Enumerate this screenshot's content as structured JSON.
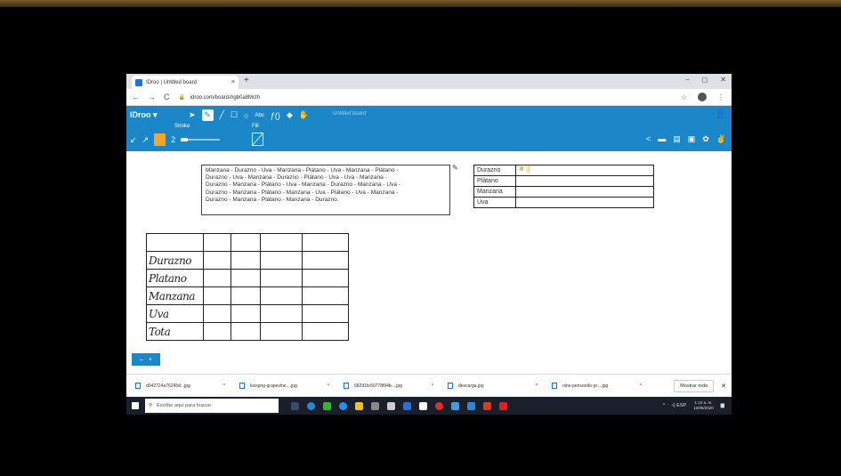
{
  "browser": {
    "tab_title": "IDroo | Untitled board",
    "tab_close": "×",
    "new_tab": "+",
    "win_min": "–",
    "win_max": "◻",
    "win_close": "✕",
    "nav_back": "←",
    "nav_forward": "→",
    "nav_reload": "C",
    "url": "idroo.com/board-hgb0a8Mcth",
    "star": "☆",
    "menu": "⋮"
  },
  "toolbar": {
    "logo": "IDroo ▾",
    "select_icon": "➤",
    "pencil_icon": "✎",
    "line_icon": "╱",
    "rect_icon": "☐",
    "ellipse_icon": "○",
    "text_icon": "Abc",
    "formula_icon": "ƒ()",
    "eraser_icon": "◆",
    "hand_icon": "✋",
    "board_title": "Untitled board",
    "stroke_label": "Stroke",
    "fill_label": "Fill",
    "stroke_width": "2",
    "undo_icon": "↙",
    "redo_icon": "↗",
    "share_icon": "<",
    "chat_icon": "▬",
    "doc_icon": "▤",
    "image_icon": "▣",
    "settings_icon": "✿",
    "hand2_icon": "✌",
    "user_icon": "👤",
    "stroke_color": "#f5a623",
    "accent": "#1b87c9"
  },
  "canvas": {
    "text_lines": [
      "Manzana - Durazno - Uva - Manzana - Plátano - Uva - Manzana - Plátano -",
      "Durazno - Uva - Manzana - Durazno - Plátano - Uva - Uva - Manzana -",
      "Durazno - Manzana - Plátano - Uva - Manzana - Durazno - Manzana - Uva -",
      "Durazno - Manzana - Plátano - Manzana - Uva - Plátano - Uva - Manzana -",
      "Durazno - Manzana - Plátano - Manzana - Durazno."
    ],
    "pencil_cursor": "✎",
    "tally_rows": [
      {
        "label": "Durazno",
        "marks": "𝍸 ||"
      },
      {
        "label": "Plátano",
        "marks": ""
      },
      {
        "label": "Manzana",
        "marks": ""
      },
      {
        "label": "Uva",
        "marks": ""
      }
    ],
    "grid_rows": [
      "",
      "Durazno",
      "Platano",
      "Manzana",
      "Uva",
      "Tota"
    ],
    "add_page_minus": "–",
    "add_page_plus": "+"
  },
  "downloads": {
    "items": [
      "d042724a76245d...jpg",
      "kisspng-grapevine....jpg",
      "682d1fe50778f94b....jpg",
      "descarga.jpg",
      "nino-pensando-pr....jpg"
    ],
    "chevron": "^",
    "show_all": "Mostrar todo",
    "close": "✕"
  },
  "taskbar": {
    "search_icon": "⚲",
    "search_placeholder": "Escribe aquí para buscar",
    "tray": "^  ᛫  ◁)  ESP",
    "time": "1:10 a. m.",
    "date": "10/08/2020",
    "notif_icon": "▆"
  }
}
